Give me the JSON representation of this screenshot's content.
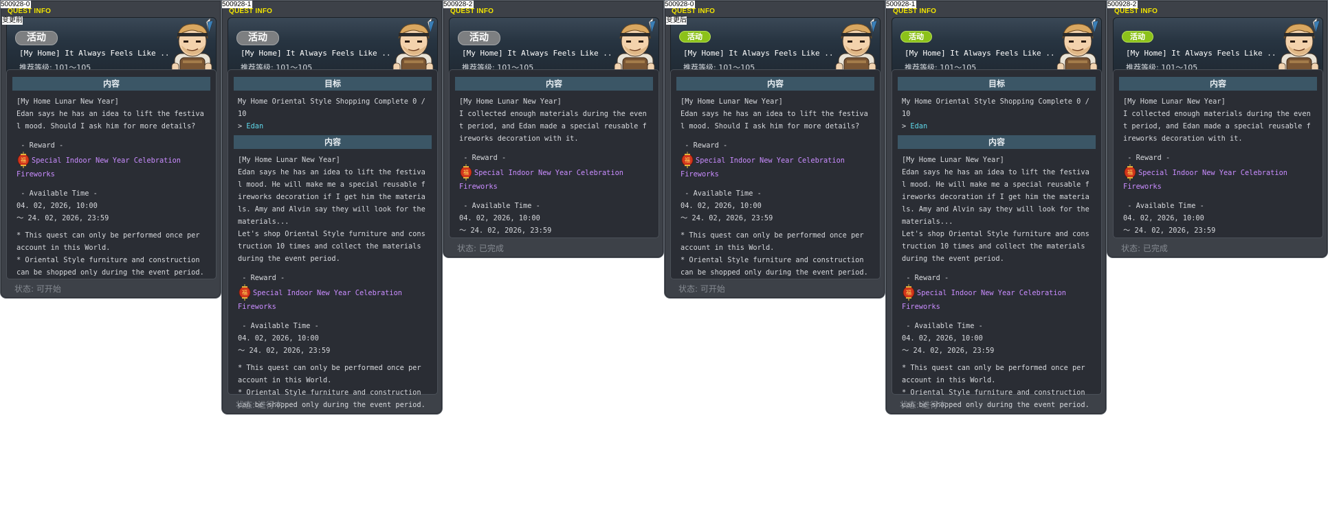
{
  "common": {
    "quest_info": "QUEST INFO",
    "quest_title": "[My Home] It Always Feels Like ..",
    "recommended_level": "推荐等级: 101～105",
    "section_content": "内容",
    "section_goal": "目标",
    "badge_label": "活动",
    "reward_heading": " - Reward -",
    "reward_item": "Special Indoor New Year Celebration Fireworks",
    "time_heading": " - Available Time -",
    "time_start": "04. 02, 2026, 10:00",
    "time_end": "～ 24. 02, 2026, 23:59",
    "note1": "* This quest can only be performed once per account in this World.",
    "note2": "* Oriental Style furniture and construction can be shopped only during the event period.",
    "goal_text": "My Home Oriental Style Shopping Complete 0 / 10",
    "goal_npc": "Edan",
    "goal_arrow": "> ",
    "desc_start": "[My Home Lunar New Year]\nEdan says he has an idea to lift the festival mood. Should I ask him for more details?",
    "desc_progress": "[My Home Lunar New Year]\nEdan says he has an idea to lift the festival mood. He will make me a special reusable fireworks decoration if I get him the materials. Amy and Alvin say they will look for the materials...\nLet's shop Oriental Style furniture and construction 10 times and collect the materials during the event period.",
    "desc_complete": "I collected enough materials during the event period, and Edan made a special reusable fireworks decoration with it."
  },
  "panels": [
    {
      "id": "500928-0",
      "sublabel": "变更前",
      "status": "状态:  可开始"
    },
    {
      "id": "500928-1",
      "sublabel": "",
      "status": "状态:  进行中"
    },
    {
      "id": "500928-2",
      "sublabel": "",
      "status": "状态:  已完成"
    },
    {
      "id": "500928-0",
      "sublabel": "变更后",
      "status": "状态:  可开始"
    },
    {
      "id": "500928-1",
      "sublabel": "",
      "status": "状态:  进行中"
    },
    {
      "id": "500928-2",
      "sublabel": "",
      "status": "状态:  已完成"
    }
  ],
  "colors": {
    "badge_gray": "#7d7f81",
    "badge_green": "#8cc21a",
    "quest_info_yellow": "#f4e600",
    "npc_name_cyan": "#5fd8ea",
    "reward_purple": "#c98cff",
    "section_bar": "#3b5666"
  },
  "icons": {
    "npc": "edan-npc-portrait",
    "reward": "firework-lantern-icon"
  }
}
